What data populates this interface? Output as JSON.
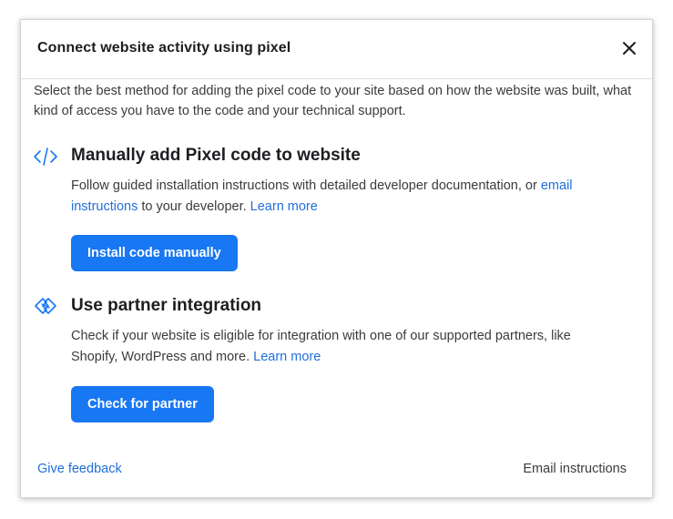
{
  "dialog": {
    "title": "Connect website activity using pixel",
    "close_icon": "close-icon",
    "intro": "Select the best method for adding the pixel code to your site based on how the website was built, what kind of access you have to the code and your technical support."
  },
  "manual": {
    "icon": "code-icon",
    "title": "Manually add Pixel code to website",
    "desc_part1": "Follow guided installation instructions with detailed developer documentation, or ",
    "email_link": "email instructions",
    "desc_part2": " to your developer. ",
    "learn_more": "Learn more",
    "button": "Install code manually"
  },
  "partner": {
    "icon": "handshake-icon",
    "title": "Use partner integration",
    "desc_part1": "Check if your website is eligible for integration with one of our supported partners, like Shopify, WordPress and more. ",
    "learn_more": "Learn more",
    "button": "Check for partner"
  },
  "footer": {
    "give_feedback": "Give feedback",
    "email_instructions": "Email instructions"
  },
  "colors": {
    "primary": "#1877f2",
    "link": "#216fdb",
    "text": "#1c1e21",
    "secondary_text": "#3a3b3d"
  }
}
